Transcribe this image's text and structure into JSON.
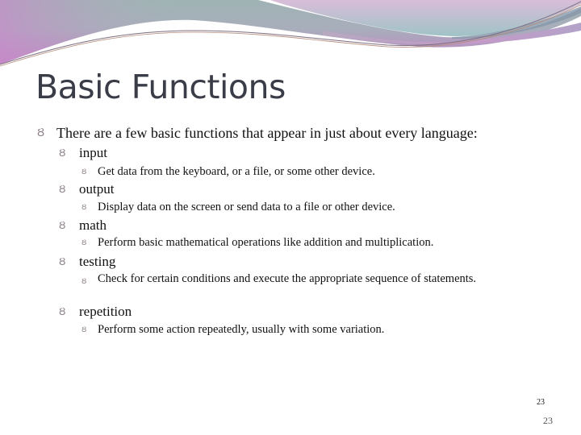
{
  "slide": {
    "title": "Basic Functions",
    "bullet_icon": "curl-bullet-icon",
    "bullet_glyph": "Ȣ",
    "intro": "There are a few basic functions that appear in just about every language:",
    "functions": [
      {
        "name": "input",
        "description": "Get data from the keyboard, or a file, or some other device."
      },
      {
        "name": "output",
        "description": "Display data on the screen or send data to a file or other device."
      },
      {
        "name": "math",
        "description": "Perform basic mathematical operations like addition and multiplication."
      },
      {
        "name": "testing",
        "description": "Check for certain conditions and execute the appropriate sequence of statements."
      },
      {
        "name": "repetition",
        "description": "Perform some action repeatedly, usually with some variation."
      }
    ],
    "page_number": "23",
    "footer_page_number": "23"
  },
  "theme": {
    "title_color": "#3a3c48",
    "wave_teal": "#9fb3b4",
    "wave_pink": "#c48ac4",
    "wave_lavender": "#d6bfd8",
    "wave_aqua": "#a7c4c6"
  }
}
